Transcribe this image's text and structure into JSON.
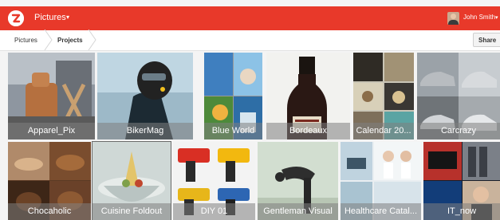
{
  "header": {
    "app_title": "Pictures",
    "caret": "▾",
    "user_name": "John Smith",
    "brand_color": "#e8392a"
  },
  "breadcrumb": {
    "items": [
      "Pictures",
      "Projects"
    ],
    "share_label": "Share"
  },
  "projects": [
    {
      "name": "Apparel_Pix"
    },
    {
      "name": "BikerMag"
    },
    {
      "name": "Blue World"
    },
    {
      "name": "Bordeaux"
    },
    {
      "name": "Calendar 20..."
    },
    {
      "name": "Carcrazy"
    },
    {
      "name": "Chocaholic"
    },
    {
      "name": "Cuisine Foldout"
    },
    {
      "name": "DIY 01"
    },
    {
      "name": "Gentleman Visual"
    },
    {
      "name": "Healthcare Catal..."
    },
    {
      "name": "IT_now"
    }
  ]
}
